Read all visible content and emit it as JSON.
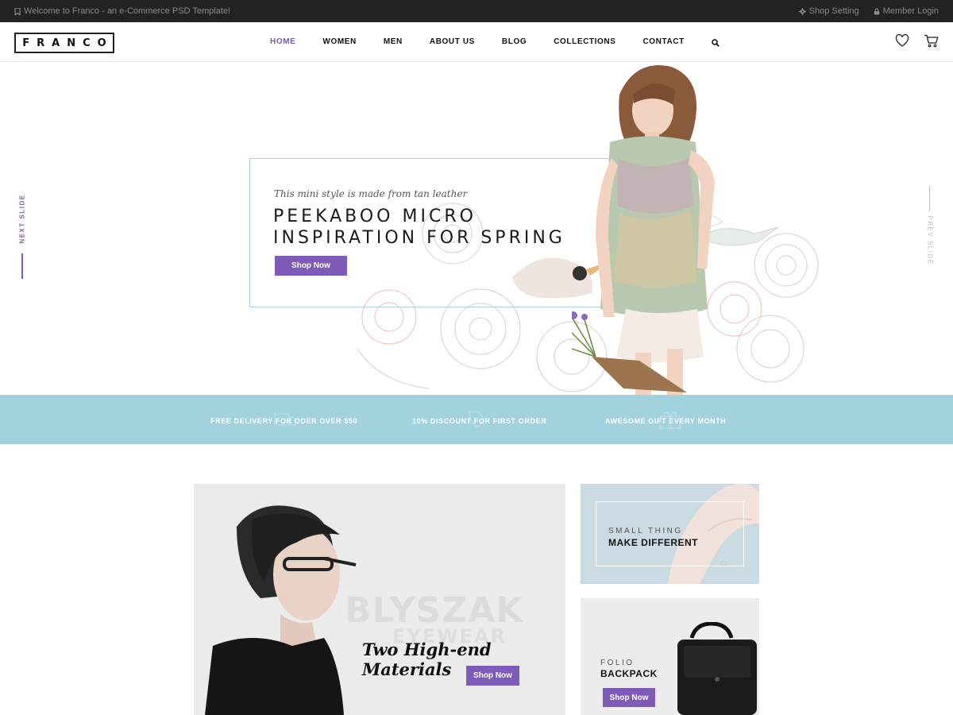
{
  "topbar": {
    "welcome": "Welcome to Franco - an e-Commerce PSD Template!",
    "shop_setting": "Shop Setting",
    "member_login": "Member Login"
  },
  "header": {
    "logo": "FRANCO",
    "nav": [
      "HOME",
      "WOMEN",
      "MEN",
      "ABOUT US",
      "BLOG",
      "COLLECTIONS",
      "CONTACT"
    ],
    "active_item": "HOME"
  },
  "hero": {
    "subtitle": "This mini style is made from tan leather",
    "title_line1": "PEEKABOO MICRO",
    "title_line2": "INSPIRATION FOR SPRING",
    "button": "Shop Now",
    "next_slide": "NEXT SLIDE",
    "prev_slide": "PREV SLIDE"
  },
  "promo_band": {
    "items": [
      "FREE DELIVERY FOR ODER OVER $50",
      "10% DISCOUNT FOR FIRST ORDER",
      "AWESOME GIFT EVERY MONTH"
    ]
  },
  "banners": {
    "eyewear": {
      "brand": "BLYSZAK",
      "brand_sub": "EYEWEAR",
      "tagline": "Two High-end Materials",
      "button": "Shop Now"
    },
    "small_thing": {
      "line1": "SMALL THING",
      "line2": "MAKE DIFFERENT"
    },
    "backpack": {
      "line1": "FOLIO",
      "line2": "BACKPACK",
      "button": "Shop Now"
    }
  },
  "colors": {
    "accent": "#7e5bb7",
    "band": "#a3d2df",
    "topbar": "#222222"
  }
}
